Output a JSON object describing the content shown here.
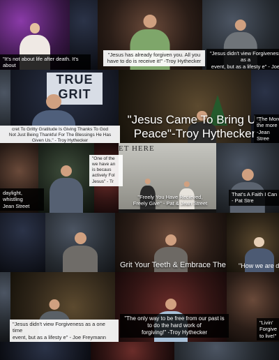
{
  "collage": {
    "captions": {
      "not_about_life_after_death": "\"It's not about life after death. It's about\nlife before death\" -Jean Street",
      "already_forgiven": "\"Jesus has already forgiven you. All you\nhave to do is receive it!\" -Troy Hythecker",
      "view_forgiveness_top": "\"Jesus didn't view Forgiveness as a\nevent, but as a lifesty e\" - Joe",
      "gritty_gratitude": "cret To Gritty Gratitude Is Giving Thanks To God\nNot Just Being Thankful For The Blessings He Has\nGiven Us.\" - Troy Hythecker",
      "more_right_edge": "\"The More\nthe more\n-Jean Stree",
      "daylight_whistling": "daylight, whistling\nJean Street",
      "one_of_the": "\"One of the\nwe have an\nis becaus\nactively Fol\nJesus\" - Tr",
      "freely_received": "\"Freely You Have Recieved,\nFreely Give\" - Pat & Jean Street",
      "faith_i_can": "That's A Faith I Can\n- Pat Stre",
      "how_we_are": "\"How we are d",
      "view_forgiveness_bottom": "\"Jesus didn't view Forgiveness as a one time\nevent, but as a lifesty e\" - Joe Freymann",
      "free_from_past": "\"The only way to be free from our past is\nto do the hard work of\nforgiving!\" -Troy Hythecker",
      "livin_forgive": "\"Livin' Forgive\nto live!\""
    },
    "big_quote": "\"Jesus Came To Bring Us\nPeace\"-Troy Hythecker",
    "grit_banner": "Grit Your Teeth & Embrace The",
    "sign_true_grit": "TRUE\nGRIT",
    "wall_text": "ET HERE"
  },
  "colors": {
    "caption_bg": "#000000",
    "caption_text": "#ffffff"
  }
}
